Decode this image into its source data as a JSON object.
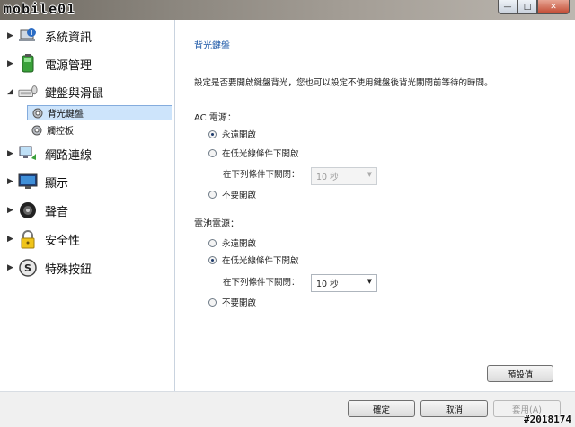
{
  "watermark": "mobile01",
  "window_buttons": {
    "minimize": "—",
    "maximize": "□",
    "close": "✕"
  },
  "sidebar": {
    "items": [
      {
        "label": "系統資訊",
        "icon": "laptop-info-icon",
        "arrow": "▶"
      },
      {
        "label": "電源管理",
        "icon": "battery-icon",
        "arrow": "▶"
      },
      {
        "label": "鍵盤與滑鼠",
        "icon": "keyboard-mouse-icon",
        "arrow": "◢"
      },
      {
        "label": "網路連線",
        "icon": "network-icon",
        "arrow": "▶"
      },
      {
        "label": "顯示",
        "icon": "monitor-icon",
        "arrow": "▶"
      },
      {
        "label": "聲音",
        "icon": "speaker-icon",
        "arrow": "▶"
      },
      {
        "label": "安全性",
        "icon": "lock-icon",
        "arrow": "▶"
      },
      {
        "label": "特殊按鈕",
        "icon": "special-button-icon",
        "arrow": "▶"
      }
    ],
    "subitems": [
      {
        "label": "背光鍵盤",
        "icon": "gear-icon",
        "selected": true
      },
      {
        "label": "觸控板",
        "icon": "gear-icon",
        "selected": false
      }
    ]
  },
  "content": {
    "heading": "背光鍵盤",
    "description": "設定是否要開啟鍵盤背光，您也可以設定不使用鍵盤後背光關閉前等待的時間。",
    "ac": {
      "title": "AC 電源：",
      "options": [
        "永遠開啟",
        "在低光線條件下開啟",
        "不要開啟"
      ],
      "selected_index": 0,
      "delay_label": "在下列條件下關閉：",
      "delay_value": "10 秒",
      "delay_enabled": false
    },
    "battery": {
      "title": "電池電源：",
      "options": [
        "永遠開啟",
        "在低光線條件下開啟",
        "不要開啟"
      ],
      "selected_index": 1,
      "delay_label": "在下列條件下關閉：",
      "delay_value": "10 秒",
      "delay_enabled": true
    },
    "defaults_button": "預設值"
  },
  "footer": {
    "ok": "確定",
    "cancel": "取消",
    "apply": "套用(A)"
  },
  "stamp": "#2018174"
}
